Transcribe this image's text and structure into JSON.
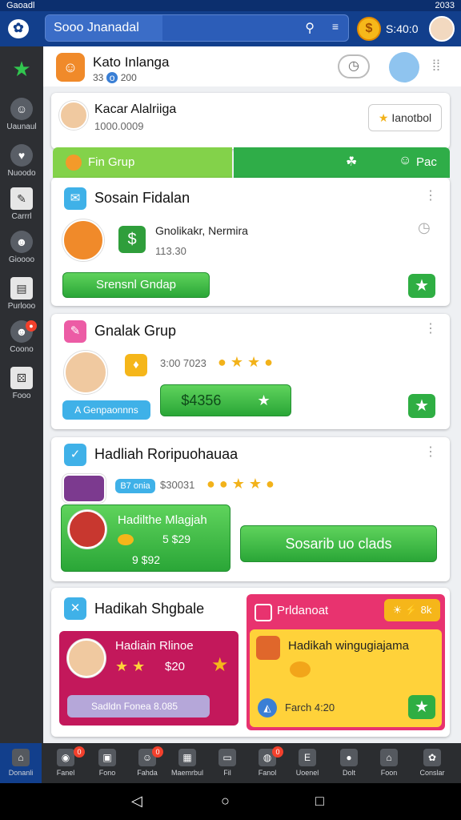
{
  "status": {
    "left": "Gaoadl",
    "right": "2033"
  },
  "header": {
    "search_title": "Sooo Jnanadal",
    "coin_value": "S:40:0"
  },
  "sidebar": {
    "items": [
      {
        "label": "Uaunaul",
        "icon": "user-icon"
      },
      {
        "label": "Nuoodo",
        "icon": "chat-icon"
      },
      {
        "label": "Carrrl",
        "icon": "edit-icon"
      },
      {
        "label": "Gioooo",
        "icon": "avatar-icon"
      },
      {
        "label": "Purlooo",
        "icon": "list-icon"
      },
      {
        "label": "Coono",
        "icon": "avatar-icon"
      },
      {
        "label": "Fooo",
        "icon": "dice-icon"
      }
    ]
  },
  "profile": {
    "name": "Kato Inlanga",
    "sub": "33",
    "sub2": "200"
  },
  "top_card": {
    "name": "Kacar Alalriiga",
    "sub": "1000.0009",
    "button": "Ianotbol"
  },
  "tabs": {
    "t1": "Fin Grup",
    "t2": "Pac"
  },
  "cards": [
    {
      "title": "Sosain Fidalan",
      "item": "Gnolikakr, Nermira",
      "value": "113.30",
      "button": "Srensnl Gndap"
    },
    {
      "title": "Gnalak Grup",
      "stats": "3:00 7023",
      "chip": "A Genpaonnns",
      "price": "$4356"
    },
    {
      "title": "Hadliah Roripuohauaa",
      "tag": "B7 onia",
      "stats": "$30031",
      "inner_title": "Hadilthe Mlagjah",
      "inner_v1": "5 $29",
      "inner_v2": "9 $92",
      "button": "Sosarib uo clads"
    },
    {
      "title": "Hadikah Shgbale",
      "left_title": "Hadiain Rlinoe",
      "left_value": "$20",
      "left_bar": "Sadldn Fonea 8.085",
      "right_head": "Prldanoat",
      "right_badge": "8k",
      "right_title": "Hadikah wingugiajama",
      "right_foot": "Farch 4:20"
    }
  ],
  "bottom_nav": [
    {
      "label": "Donanli"
    },
    {
      "label": "Fanel"
    },
    {
      "label": "Fono"
    },
    {
      "label": "Fahda"
    },
    {
      "label": "Maemrbul"
    },
    {
      "label": "Fil"
    },
    {
      "label": "Fanol"
    },
    {
      "label": "Uoenel"
    },
    {
      "label": "Dolt"
    },
    {
      "label": "Foon"
    },
    {
      "label": "Conslar"
    }
  ],
  "colors": {
    "header": "#123f8c",
    "accent_green": "#2fad48",
    "pink": "#e8336f",
    "yellow": "#ffd23a"
  }
}
